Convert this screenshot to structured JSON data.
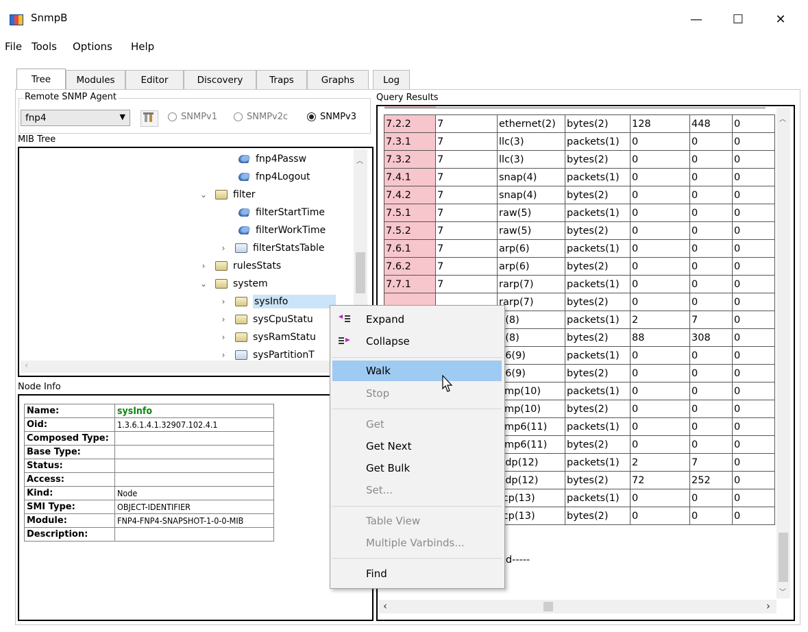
{
  "window": {
    "title": "SnmpB",
    "minimize": "—",
    "maximize": "☐",
    "close": "✕"
  },
  "menu": [
    "File",
    "Tools",
    "Options",
    "Help"
  ],
  "tabs": [
    "Tree",
    "Modules",
    "Editor",
    "Discovery",
    "Traps",
    "Graphs",
    "Log"
  ],
  "agent": {
    "group_label": "Remote SNMP Agent",
    "selected": "fnp4",
    "versions": [
      "SNMPv1",
      "SNMPv2c",
      "SNMPv3"
    ],
    "checked_version": "SNMPv3"
  },
  "mib_tree": {
    "label": "MIB Tree",
    "nodes": [
      {
        "label": "fnp4Passw",
        "icon": "leaf-icon",
        "chevron": ""
      },
      {
        "label": "fnp4Logout",
        "icon": "leaf-icon",
        "chevron": ""
      },
      {
        "label": "filter",
        "icon": "folder-icon",
        "chevron": "⌄"
      },
      {
        "label": "filterStartTime",
        "icon": "leaf-icon",
        "chevron": ""
      },
      {
        "label": "filterWorkTime",
        "icon": "leaf-icon",
        "chevron": ""
      },
      {
        "label": "filterStatsTable",
        "icon": "table-folder-icon",
        "chevron": "›"
      },
      {
        "label": "rulesStats",
        "icon": "folder-icon",
        "chevron": "›"
      },
      {
        "label": "system",
        "icon": "folder-icon",
        "chevron": "⌄"
      },
      {
        "label": "sysInfo",
        "icon": "folder-icon",
        "chevron": "›"
      },
      {
        "label": "sysCpuStatu",
        "icon": "folder-icon",
        "chevron": "›"
      },
      {
        "label": "sysRamStatu",
        "icon": "folder-icon",
        "chevron": "›"
      },
      {
        "label": "sysPartitionT",
        "icon": "table-folder-icon",
        "chevron": "›"
      }
    ]
  },
  "node_info": {
    "label": "Node Info",
    "rows": [
      {
        "key": "Name:",
        "value": "sysInfo"
      },
      {
        "key": "Oid:",
        "value": "1.3.6.1.4.1.32907.102.4.1"
      },
      {
        "key": "Composed Type:",
        "value": ""
      },
      {
        "key": "Base Type:",
        "value": ""
      },
      {
        "key": "Status:",
        "value": ""
      },
      {
        "key": "Access:",
        "value": ""
      },
      {
        "key": "Kind:",
        "value": "Node"
      },
      {
        "key": "SMI Type:",
        "value": "OBJECT-IDENTIFIER"
      },
      {
        "key": "Module:",
        "value": "FNP4-FNP4-SNAPSHOT-1-0-0-MIB"
      },
      {
        "key": "Description:",
        "value": ""
      }
    ]
  },
  "query_results": {
    "label": "Query Results",
    "rows": [
      [
        "7.2.2",
        "7",
        "ethernet(2)",
        "bytes(2)",
        "128",
        "448",
        "0"
      ],
      [
        "7.3.1",
        "7",
        "llc(3)",
        "packets(1)",
        "0",
        "0",
        "0"
      ],
      [
        "7.3.2",
        "7",
        "llc(3)",
        "bytes(2)",
        "0",
        "0",
        "0"
      ],
      [
        "7.4.1",
        "7",
        "snap(4)",
        "packets(1)",
        "0",
        "0",
        "0"
      ],
      [
        "7.4.2",
        "7",
        "snap(4)",
        "bytes(2)",
        "0",
        "0",
        "0"
      ],
      [
        "7.5.1",
        "7",
        "raw(5)",
        "packets(1)",
        "0",
        "0",
        "0"
      ],
      [
        "7.5.2",
        "7",
        "raw(5)",
        "bytes(2)",
        "0",
        "0",
        "0"
      ],
      [
        "7.6.1",
        "7",
        "arp(6)",
        "packets(1)",
        "0",
        "0",
        "0"
      ],
      [
        "7.6.2",
        "7",
        "arp(6)",
        "bytes(2)",
        "0",
        "0",
        "0"
      ],
      [
        "7.7.1",
        "7",
        "rarp(7)",
        "packets(1)",
        "0",
        "0",
        "0"
      ],
      [
        "",
        "",
        "rarp(7)",
        "bytes(2)",
        "0",
        "0",
        "0"
      ],
      [
        "",
        "",
        "p(8)",
        "packets(1)",
        "2",
        "7",
        "0"
      ],
      [
        "",
        "",
        "p(8)",
        "bytes(2)",
        "88",
        "308",
        "0"
      ],
      [
        "",
        "",
        "p6(9)",
        "packets(1)",
        "0",
        "0",
        "0"
      ],
      [
        "",
        "",
        "p6(9)",
        "bytes(2)",
        "0",
        "0",
        "0"
      ],
      [
        "",
        "",
        "cmp(10)",
        "packets(1)",
        "0",
        "0",
        "0"
      ],
      [
        "",
        "",
        "cmp(10)",
        "bytes(2)",
        "0",
        "0",
        "0"
      ],
      [
        "",
        "",
        "cmp6(11)",
        "packets(1)",
        "0",
        "0",
        "0"
      ],
      [
        "",
        "",
        "cmp6(11)",
        "bytes(2)",
        "0",
        "0",
        "0"
      ],
      [
        "",
        "",
        "udp(12)",
        "packets(1)",
        "2",
        "7",
        "0"
      ],
      [
        "",
        "",
        "udp(12)",
        "bytes(2)",
        "72",
        "252",
        "0"
      ],
      [
        "",
        "",
        "tcp(13)",
        "packets(1)",
        "0",
        "0",
        "0"
      ],
      [
        "",
        "",
        "tcp(13)",
        "bytes(2)",
        "0",
        "0",
        "0"
      ]
    ],
    "footer": "ed-----"
  },
  "context_menu": {
    "items": [
      {
        "label": "Expand",
        "enabled": true
      },
      {
        "label": "Collapse",
        "enabled": true
      },
      {
        "label": "Walk",
        "enabled": true
      },
      {
        "label": "Stop",
        "enabled": false
      },
      {
        "label": "Get",
        "enabled": false
      },
      {
        "label": "Get Next",
        "enabled": true
      },
      {
        "label": "Get Bulk",
        "enabled": true
      },
      {
        "label": "Set...",
        "enabled": false
      },
      {
        "label": "Table View",
        "enabled": false
      },
      {
        "label": "Multiple Varbinds...",
        "enabled": false
      },
      {
        "label": "Find",
        "enabled": true
      }
    ],
    "highlighted": "Walk"
  },
  "colors": {
    "oid_cell": "#f7c6cc",
    "menu_highlight": "#9fcaf2",
    "name_value": "#0a8a0a"
  }
}
